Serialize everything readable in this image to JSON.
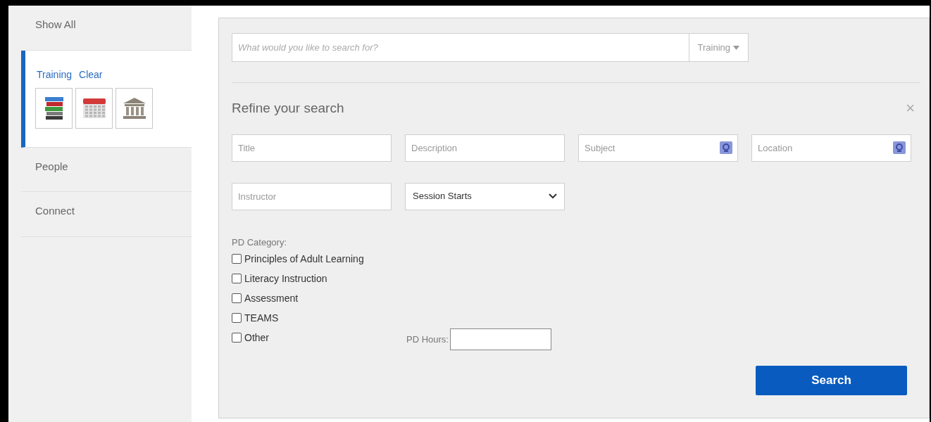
{
  "sidebar": {
    "items": [
      {
        "kind": "link",
        "label": "Show All",
        "selected": false
      },
      {
        "kind": "filter",
        "label": "Training",
        "clear": "Clear",
        "selected": true
      },
      {
        "kind": "link",
        "label": "People",
        "selected": false
      },
      {
        "kind": "link",
        "label": "Connect",
        "selected": false
      }
    ]
  },
  "search": {
    "placeholder": "What would you like to search for?",
    "scope": "Training"
  },
  "refine": {
    "title": "Refine your search",
    "close": "×",
    "fields": [
      {
        "kind": "text",
        "placeholder": "Title"
      },
      {
        "kind": "text",
        "placeholder": "Description"
      },
      {
        "kind": "lookup",
        "placeholder": "Subject"
      },
      {
        "kind": "lookup",
        "placeholder": "Location"
      },
      {
        "kind": "text",
        "placeholder": "Instructor"
      },
      {
        "kind": "select",
        "value": "Session Starts"
      }
    ],
    "category_label": "PD Category:",
    "categories": [
      {
        "label": "Principles of Adult Learning",
        "checked": false
      },
      {
        "label": "Literacy Instruction",
        "checked": false
      },
      {
        "label": "Assessment",
        "checked": false
      },
      {
        "label": "TEAMS",
        "checked": false
      },
      {
        "label": "Other",
        "checked": false
      }
    ],
    "hours_label": "PD Hours:",
    "button": "Search"
  }
}
